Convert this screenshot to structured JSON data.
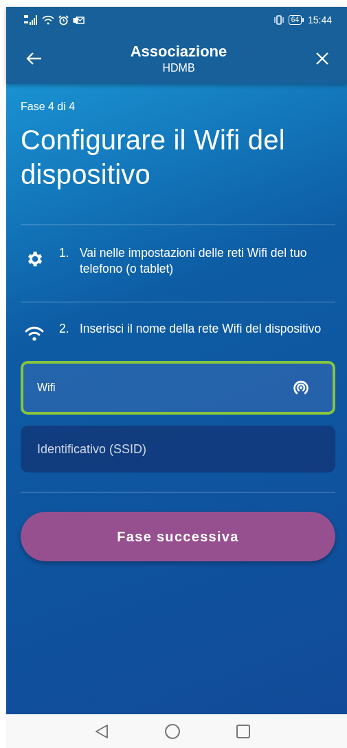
{
  "status_bar": {
    "battery": "64",
    "time": "15:44"
  },
  "app_bar": {
    "title": "Associazione",
    "subtitle": "HDMB"
  },
  "step_counter": "Fase 4 di 4",
  "heading": "Configurare il Wifi del dispositivo",
  "steps": [
    {
      "kind": "gear",
      "number": "1.",
      "text": "Vai nelle impostazioni delle reti Wifi del tuo telefono (o tablet)"
    },
    {
      "kind": "wifi",
      "number": "2.",
      "text": "Inserisci il nome della rete Wifi del dispositivo"
    }
  ],
  "fields": [
    {
      "kind": "picker",
      "value": "Wifi",
      "focused": true
    },
    {
      "kind": "text",
      "placeholder": "Identificativo (SSID)",
      "focused": false
    }
  ],
  "next_button": {
    "label": "Fase successiva"
  }
}
